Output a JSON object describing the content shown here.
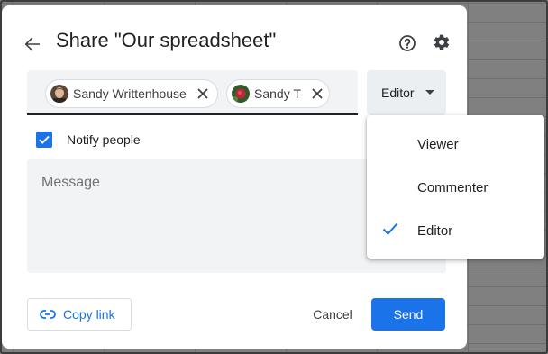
{
  "dialog": {
    "title": "Share \"Our spreadsheet\"",
    "back_icon": "arrow-back-icon",
    "help_icon": "help-circle-icon",
    "settings_icon": "gear-icon"
  },
  "recipients": [
    {
      "name": "Sandy Writtenhouse",
      "avatar": "person-photo"
    },
    {
      "name": "Sandy T",
      "avatar": "flower-photo"
    }
  ],
  "role_select": {
    "selected": "Editor"
  },
  "notify": {
    "label": "Notify people",
    "checked": true
  },
  "message": {
    "placeholder": "Message",
    "value": ""
  },
  "footer": {
    "copy_link_label": "Copy link",
    "cancel_label": "Cancel",
    "send_label": "Send"
  },
  "role_menu": {
    "items": [
      {
        "label": "Viewer",
        "selected": false
      },
      {
        "label": "Commenter",
        "selected": false
      },
      {
        "label": "Editor",
        "selected": true
      }
    ]
  },
  "colors": {
    "accent": "#1a73e8",
    "text": "#202124",
    "field_bg": "#f1f3f4"
  }
}
